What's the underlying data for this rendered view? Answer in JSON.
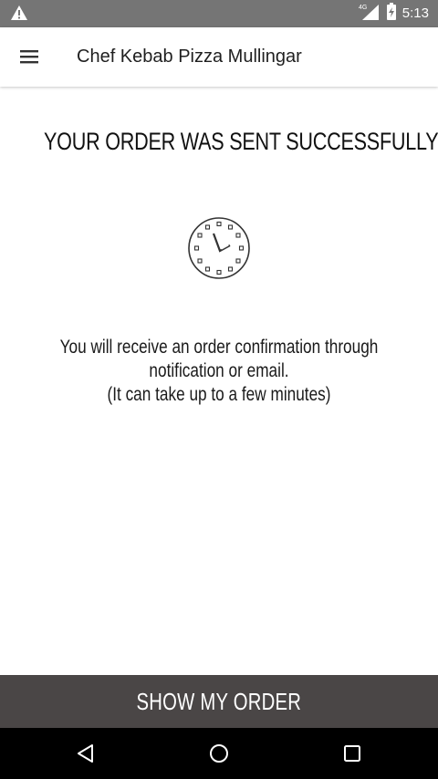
{
  "status_bar": {
    "time": "5:13",
    "network_label": "4G",
    "icons": [
      "warning-icon",
      "signal-icon",
      "battery-icon"
    ]
  },
  "app_bar": {
    "title": "Chef Kebab Pizza Mullingar",
    "menu_icon": "hamburger-menu-icon"
  },
  "content": {
    "headline": "YOUR ORDER WAS SENT SUCCESSFULLY",
    "status_icon": "clock-icon",
    "message_lines": [
      "You will receive an order confirmation through",
      "notification or email.",
      "(It can take up to a few minutes)"
    ]
  },
  "footer": {
    "button_label": "SHOW MY ORDER"
  },
  "nav_bar": {
    "icons": [
      "back-icon",
      "home-icon",
      "recents-icon"
    ]
  },
  "colors": {
    "status_bar_bg": "#757575",
    "button_bg": "#4a4646",
    "nav_bar_bg": "#000000",
    "text": "#111111"
  }
}
